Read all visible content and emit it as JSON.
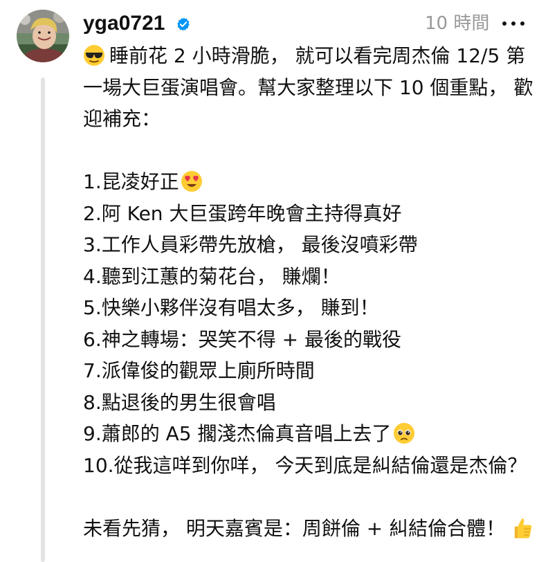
{
  "post": {
    "username": "yga0721",
    "time": "10 時間",
    "intro": [
      "睡前花 2 小時滑脆， 就可以看完周杰倫 12/5 第",
      "一場大巨蛋演唱會。幫大家整理以下 10 個重點， 歡",
      "迎補充："
    ],
    "items": [
      "1.昆凌好正",
      "2.阿 Ken 大巨蛋跨年晚會主持得真好",
      "3.工作人員彩帶先放槍， 最後沒噴彩帶",
      "4.聽到江蕙的菊花台， 賺爛！",
      "5.快樂小夥伴沒有唱太多， 賺到！",
      "6.神之轉場：哭笑不得 + 最後的戰役",
      "7.派偉俊的觀眾上廁所時間",
      "8.點退後的男生很會唱",
      "9.蕭郎的 A5 擱淺杰倫真音唱上去了",
      "10.從我這咩到你咩， 今天到底是糾結倫還是杰倫？"
    ],
    "outro": "未看先猜， 明天嘉賓是：周餅倫 + 糾結倫合體！"
  },
  "icons": {
    "verified": "verified-badge-icon",
    "more": "more-options-icon",
    "sunglasses": "sunglasses-emoji-icon",
    "heart_eyes": "heart-eyes-emoji-icon",
    "pleading": "pleading-face-emoji-icon",
    "thumbs_up": "thumbs-up-emoji-icon"
  },
  "colors": {
    "verified_blue": "#0095f6",
    "muted_text": "#999999",
    "thread_line": "#e3e3e3"
  }
}
